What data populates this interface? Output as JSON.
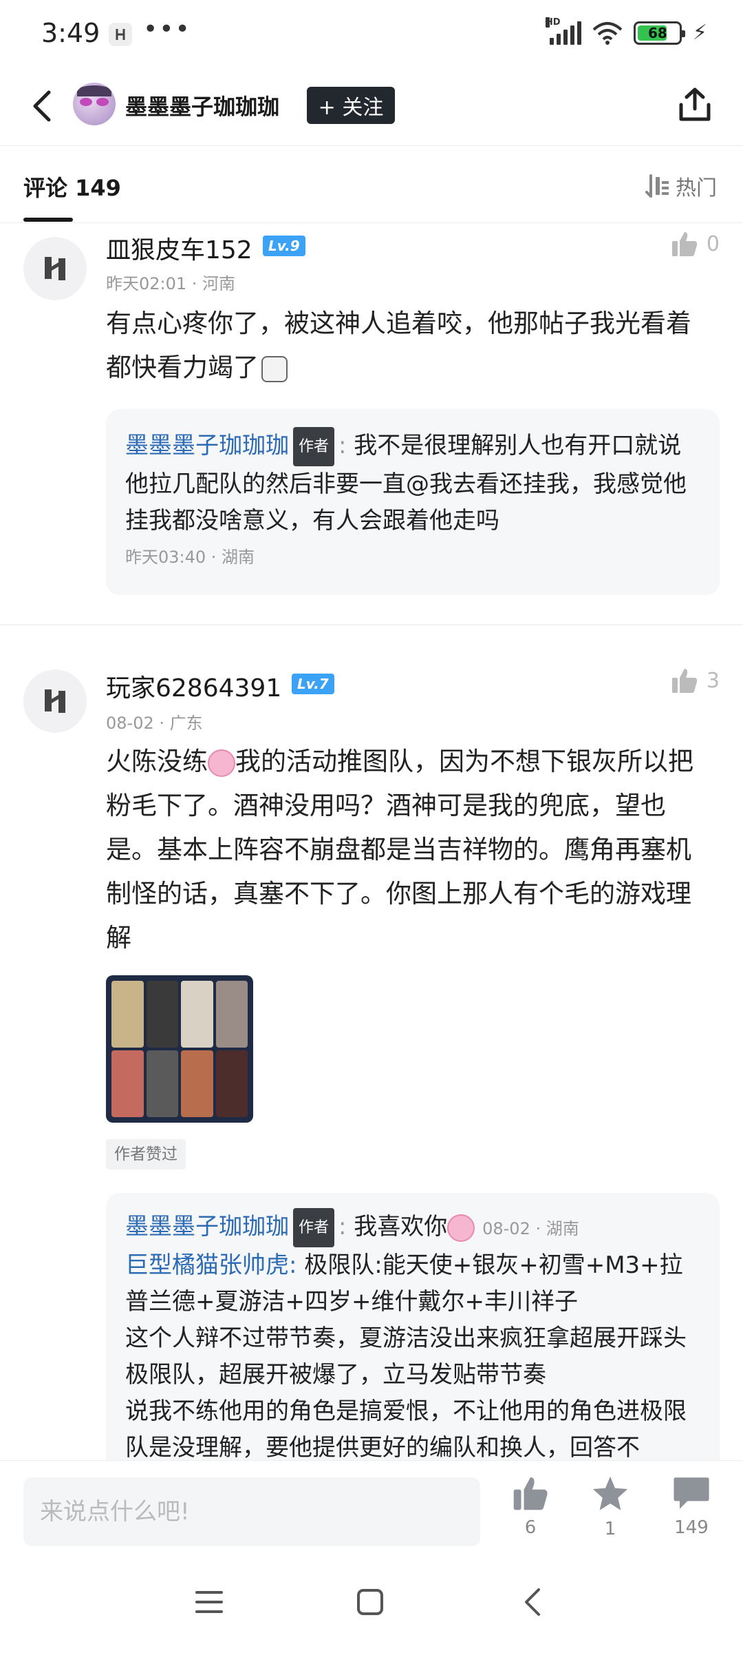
{
  "status_bar": {
    "time": "3:49",
    "dots": "•••",
    "hd_label": "HD",
    "battery": "68"
  },
  "header": {
    "author_name": "墨墨墨子珈珈珈",
    "follow_label": "+ 关注"
  },
  "tabs": {
    "comments_label": "评论 149",
    "sort_label": "热门"
  },
  "comments": [
    {
      "username": "皿狠皮车152",
      "level": "Lv.9",
      "meta": "昨天02:01 · 河南",
      "likes": "0",
      "body": "有点心疼你了，被这神人追着咬，他那帖子我光看着都快看力竭了",
      "reply": {
        "author": "墨墨墨子珈珈珈",
        "author_tag": "作者",
        "separator": ":",
        "text": "我不是很理解别人也有开口就说他拉几配队的然后非要一直@我去看还挂我，我感觉他挂我都没啥意义，有人会跟着他走吗",
        "meta": "昨天03:40 · 湖南"
      }
    },
    {
      "username": "玩家62864391",
      "level": "Lv.7",
      "meta": "08-02 · 广东",
      "likes": "3",
      "body_part1": "火陈没练",
      "body_part2": "我的活动推图队，因为不想下银灰所以把粉毛下了。酒神没用吗？酒神可是我的兜底，望也是。基本上阵容不崩盘都是当吉祥物的。鹰角再塞机制怪的话，真塞不下了。你图上那人有个毛的游戏理解",
      "praised_label": "作者赞过",
      "reply": {
        "author": "墨墨墨子珈珈珈",
        "author_tag": "作者",
        "separator": ":",
        "text": "我喜欢你",
        "meta": "08-02 · 湖南",
        "quote_user": "巨型橘猫张帅虎",
        "quote_text": "极限队:能天使+银灰+初雪+M3+拉普兰德+夏游洁+四岁+维什戴尔+丰川祥子",
        "line2": "这个人辩不过带节奏，夏游洁没出来疯狂拿超展开踩头极限队，超展开被爆了，立马发贴带节奏",
        "line3": "说我不练他用的角色是搞爱恨，不让他用的角色进极限队是没理解，要他提供更好的编队和换人，回答不"
      }
    }
  ],
  "bottom_bar": {
    "input_placeholder": "来说点什么吧!",
    "like_count": "6",
    "star_count": "1",
    "comment_count": "149"
  },
  "colors": {
    "accent_link": "#2d6bb5",
    "level_badge": "#3ba2f5",
    "follow_bg": "#23272e",
    "battery_green": "#33c24d"
  },
  "icons": {
    "back": "chevron-left-icon",
    "share": "share-icon",
    "sort": "sort-icon",
    "like": "thumbs-up-icon",
    "star": "star-icon",
    "comment": "comment-icon"
  }
}
